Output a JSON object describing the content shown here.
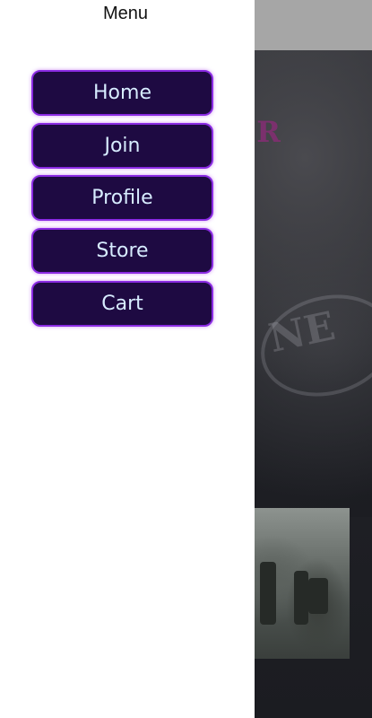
{
  "drawer": {
    "title": "Menu",
    "items": [
      {
        "label": "Home"
      },
      {
        "label": "Join"
      },
      {
        "label": "Profile"
      },
      {
        "label": "Store"
      },
      {
        "label": "Cart"
      }
    ]
  },
  "colors": {
    "button_bg": "#1e0a42",
    "button_border": "#8a2be2",
    "button_text": "#d7ecff",
    "drawer_bg": "#ffffff",
    "page_bg": "#1b1c21",
    "hero_title": "#7e2f6f"
  },
  "background_page": {
    "hero_title_visible": "TER",
    "stamp_visible": "NE"
  }
}
